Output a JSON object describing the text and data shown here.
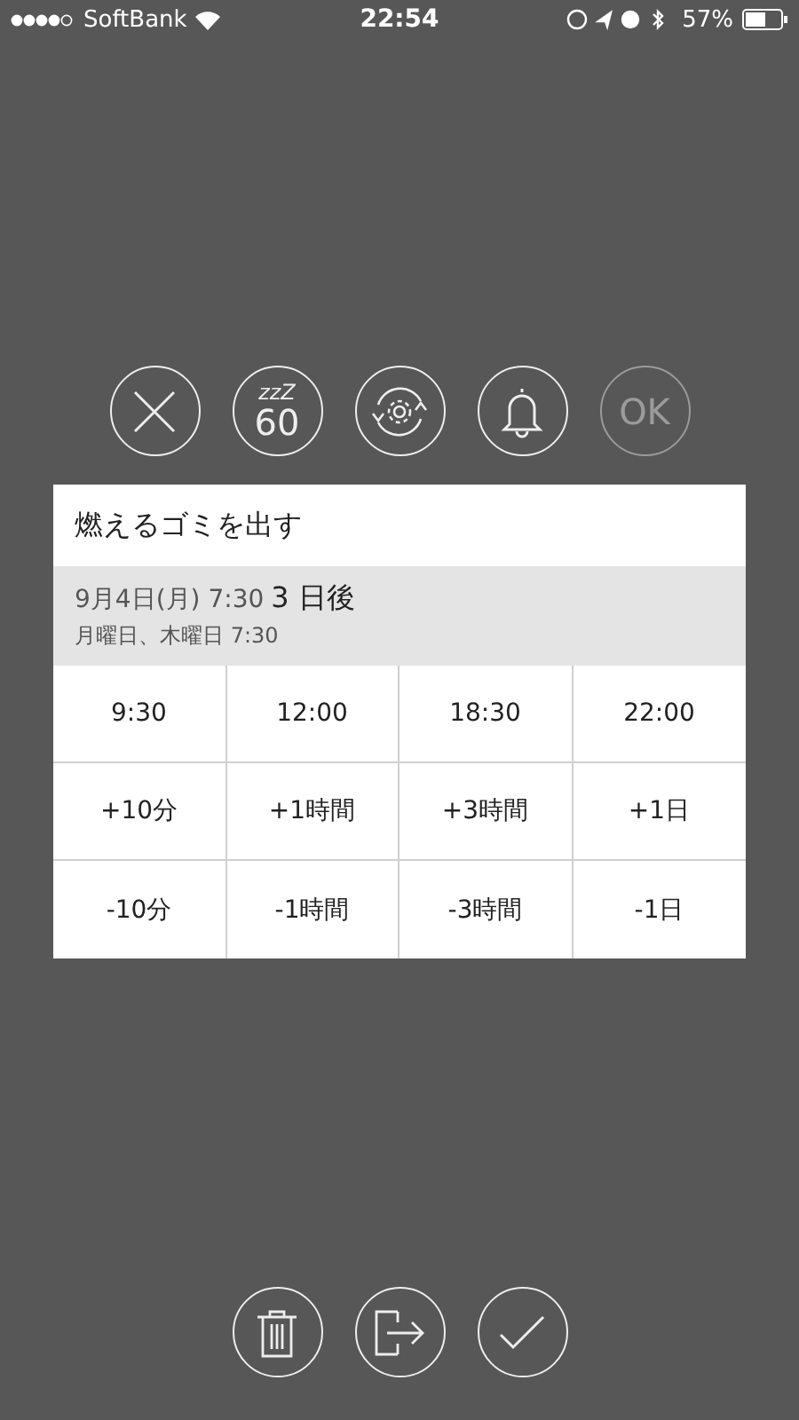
{
  "status_bar": {
    "carrier": "SoftBank",
    "time": "22:54",
    "battery": "57%"
  },
  "top_actions": [
    {
      "kind": "close",
      "disabled": false
    },
    {
      "kind": "snooze",
      "label": "zzZ",
      "value": "60",
      "disabled": false
    },
    {
      "kind": "repeat",
      "disabled": false
    },
    {
      "kind": "bell",
      "disabled": false
    },
    {
      "kind": "ok",
      "label": "OK",
      "disabled": true
    }
  ],
  "card": {
    "title": "燃えるゴミを出す",
    "date": "9月4日(月) 7:30",
    "relative": "3 日後",
    "repeat": "月曜日、木曜日 7:30",
    "grid": [
      [
        "9:30",
        "12:00",
        "18:30",
        "22:00"
      ],
      [
        "+10分",
        "+1時間",
        "+3時間",
        "+1日"
      ],
      [
        "-10分",
        "-1時間",
        "-3時間",
        "-1日"
      ]
    ]
  },
  "bottom_actions": [
    {
      "kind": "trash"
    },
    {
      "kind": "export"
    },
    {
      "kind": "check"
    }
  ]
}
